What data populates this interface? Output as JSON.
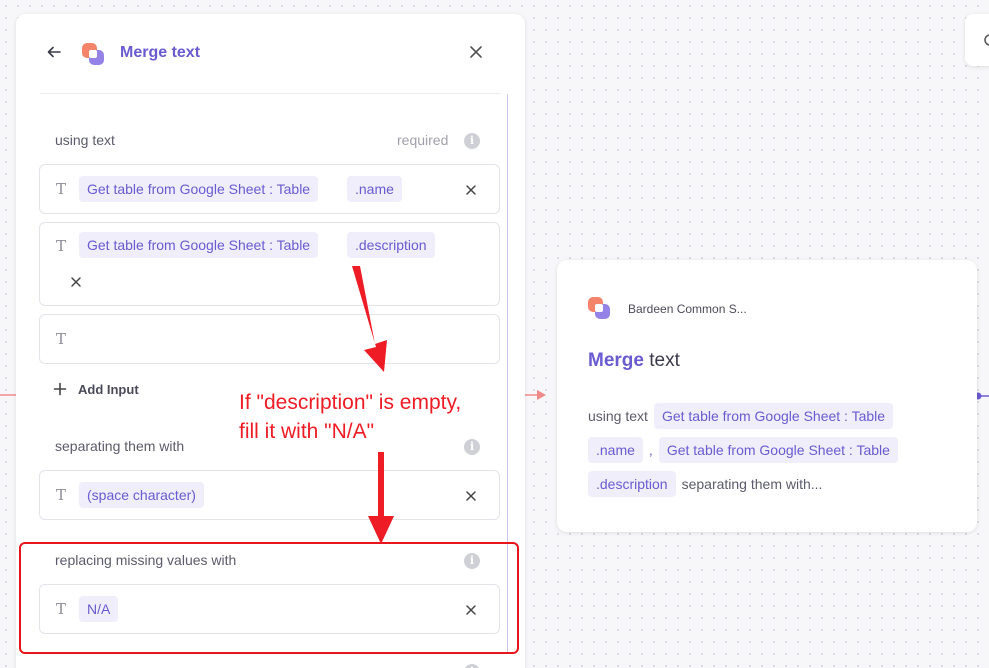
{
  "panel": {
    "title": "Merge text",
    "using_text": {
      "label": "using text",
      "required": "required",
      "inputs": [
        {
          "source": "Get table from Google Sheet : Table",
          "field": ".name"
        },
        {
          "source": "Get table from Google Sheet : Table",
          "field": ".description"
        }
      ],
      "add_input_label": "Add Input"
    },
    "separator": {
      "label": "separating them with",
      "value": "(space character)"
    },
    "missing": {
      "label": "replacing missing values with",
      "value": "N/A"
    }
  },
  "annotation": {
    "text": "If \"description\" is empty,\nfill it with \"N/A\"",
    "color": "#ee1c25"
  },
  "card": {
    "app_name": "Bardeen Common S...",
    "title_accent": "Merge",
    "title_rest": "text",
    "using_text_label": "using text",
    "chip_source_1": "Get table from Google Sheet : Table",
    "chip_field_1": ".name",
    "comma": ",",
    "chip_source_2": "Get table from Google Sheet : Table",
    "chip_field_2": ".description",
    "trailing": "separating them with..."
  },
  "colors": {
    "accent": "#6a5bd0",
    "chip_bg": "#efeefa",
    "annotation_red": "#ee1c25",
    "connector_red": "#f08a8a",
    "connector_purple": "#6a5bd0"
  },
  "icons": [
    "back-arrow-icon",
    "app-logo-icon",
    "close-icon",
    "text-type-icon",
    "remove-icon",
    "plus-icon",
    "info-icon",
    "search-icon"
  ]
}
